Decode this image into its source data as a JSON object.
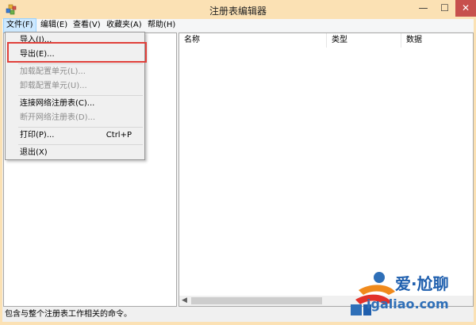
{
  "window": {
    "title": "注册表编辑器",
    "minimize_glyph": "—",
    "maximize_glyph": "☐",
    "close_glyph": "✕"
  },
  "menubar": [
    {
      "label": "文件(F)",
      "active": true
    },
    {
      "label": "编辑(E)"
    },
    {
      "label": "查看(V)"
    },
    {
      "label": "收藏夹(A)"
    },
    {
      "label": "帮助(H)"
    }
  ],
  "file_menu": {
    "items": [
      {
        "label": "导入(I)...",
        "enabled": true
      },
      {
        "label": "导出(E)...",
        "enabled": true,
        "highlighted": true
      },
      {
        "label": "加载配置单元(L)...",
        "enabled": false
      },
      {
        "label": "卸载配置单元(U)...",
        "enabled": false
      },
      {
        "label": "连接网络注册表(C)...",
        "enabled": true
      },
      {
        "label": "断开网络注册表(D)...",
        "enabled": false
      },
      {
        "label": "打印(P)...",
        "enabled": true,
        "shortcut": "Ctrl+P"
      },
      {
        "label": "退出(X)",
        "enabled": true
      }
    ]
  },
  "columns": {
    "name": "名称",
    "type": "类型",
    "data": "数据"
  },
  "statusbar": {
    "text": "包含与整个注册表工作相关的命令。"
  },
  "watermark": {
    "top_text": "爱·尬聊",
    "bottom_text": "igaliao.com",
    "colors": {
      "blue": "#1f5fae",
      "orange": "#f08a1c",
      "red": "#e2322b"
    }
  },
  "colors": {
    "titlebar": "#fbe1b4",
    "close_button": "#c7504d",
    "highlight_box": "#e0403a",
    "active_menu": "#cce8ff"
  }
}
